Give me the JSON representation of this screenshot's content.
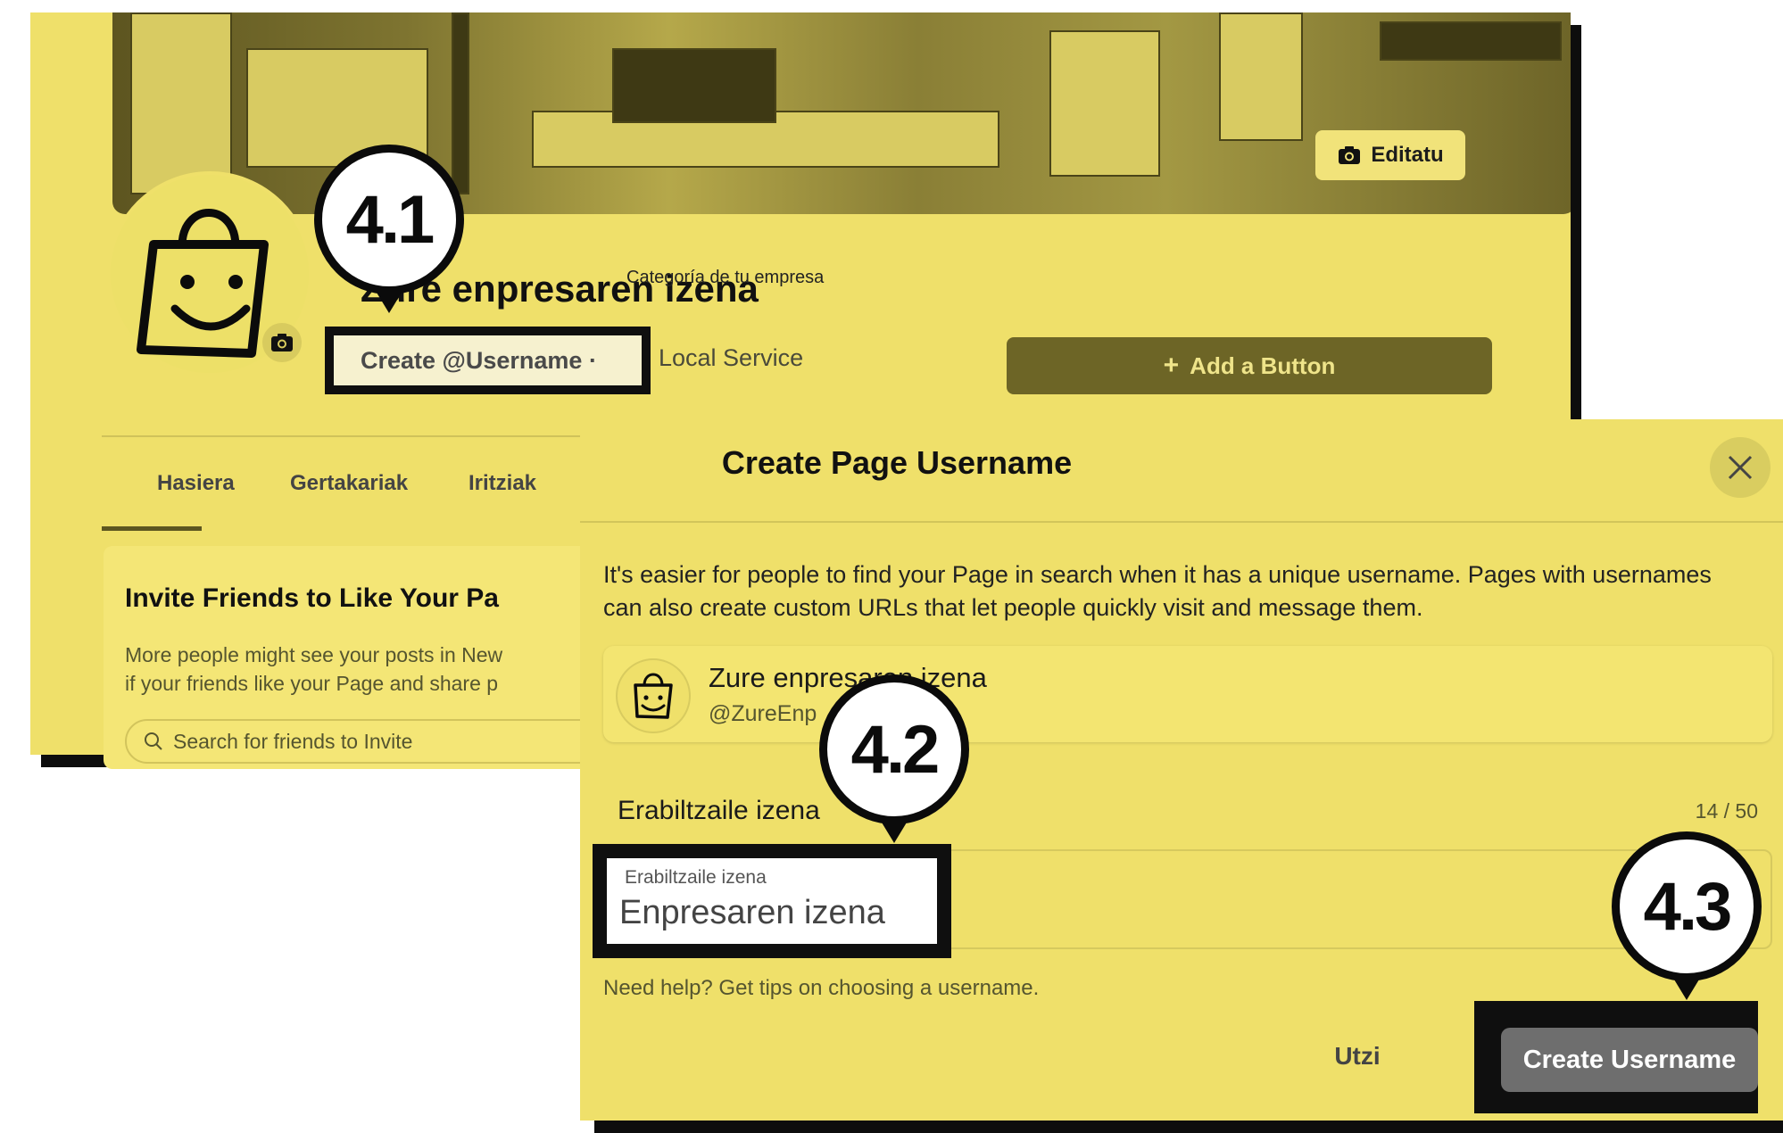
{
  "cover": {
    "edit_label": "Editatu",
    "edit_icon": "camera-icon"
  },
  "profile": {
    "name": "Zure enpresaren izena",
    "category_label": "Categoría de tu empresa",
    "create_username": "Create @Username ·",
    "category": "Local Service",
    "add_button": "Add a Button",
    "add_icon": "plus-icon",
    "avatar_icon": "shopping-bag-smiley-icon",
    "avatar_camera_icon": "camera-icon"
  },
  "tabs": [
    {
      "label": "Hasiera",
      "active": true
    },
    {
      "label": "Gertakariak",
      "active": false
    },
    {
      "label": "Iritziak",
      "active": false
    }
  ],
  "invite": {
    "title": "Invite Friends to Like Your Pa",
    "desc_line1": "More people might see your posts in New",
    "desc_line2": "if your friends like your Page and share p",
    "search_placeholder": "Search for friends to Invite"
  },
  "dialog": {
    "title": "Create Page Username",
    "description": "It's easier for people to find your Page in search when it has a unique username. Pages with usernames can also create custom URLs that let people quickly visit and message them.",
    "preview_name": "Zure enpresaren izena",
    "preview_handle": "@ZureEnp",
    "field_label": "Erabiltzaile izena",
    "char_count": "14 / 50",
    "input_label": "Erabiltzaile izena",
    "input_value": "Enpresaren izena",
    "help_text": "Need help? Get tips on choosing a username.",
    "cancel": "Utzi",
    "submit": "Create Username"
  },
  "callouts": {
    "c1": "4.1",
    "c2": "4.2",
    "c3": "4.3"
  },
  "colors": {
    "accent_yellow": "#efe06a",
    "dark_olive": "#6d6526",
    "black": "#0f0f0f",
    "button_gray": "#6e6e6e"
  }
}
